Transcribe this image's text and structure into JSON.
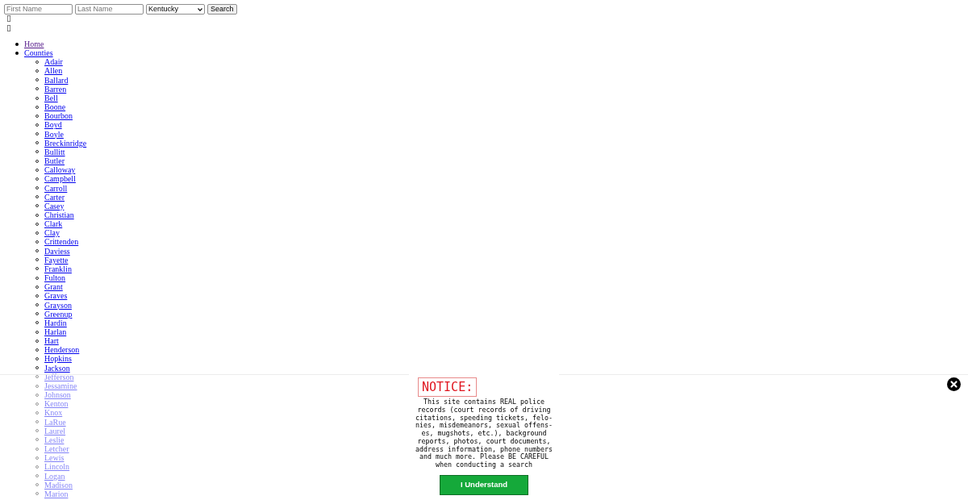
{
  "search_form": {
    "first_name": {
      "placeholder": "First Name"
    },
    "last_name": {
      "placeholder": "Last Name"
    },
    "state": {
      "value": "Kentucky"
    },
    "button": "Search"
  },
  "nav": {
    "items": [
      {
        "label": "Home",
        "visited": true
      },
      {
        "label": "Counties",
        "visited": false,
        "children": [
          "Adair",
          "Allen",
          "Ballard",
          "Barren",
          "Bell",
          "Boone",
          "Bourbon",
          "Boyd",
          "Boyle",
          "Breckinridge",
          "Bullitt",
          "Butler",
          "Calloway",
          "Campbell",
          "Carroll",
          "Carter",
          "Casey",
          "Christian",
          "Clark",
          "Clay",
          "Crittenden",
          "Daviess",
          "Fayette",
          "Franklin",
          "Fulton",
          "Grant",
          "Graves",
          "Grayson",
          "Greenup",
          "Hardin",
          "Harlan",
          "Hart",
          "Henderson",
          "Hopkins",
          "Jackson",
          "Jefferson",
          "Jessamine",
          "Johnson",
          "Kenton",
          "Knox",
          "LaRue",
          "Laurel",
          "Leslie",
          "Letcher",
          "Lewis",
          "Lincoln",
          "Logan",
          "Madison",
          "Marion"
        ]
      }
    ]
  },
  "notice": {
    "heading": "NOTICE:",
    "lines": [
      "This site contains REAL police",
      "records (court records of driving",
      "citations, speeding tickets, felo-",
      "nies, misdemeanors, sexual offens-",
      "es, mugshots, etc.), background",
      "reports, photos, court documents,",
      "address information, phone numbers",
      "and much more. Please BE CAREFUL",
      "when conducting a search"
    ],
    "button": "I Understand"
  }
}
